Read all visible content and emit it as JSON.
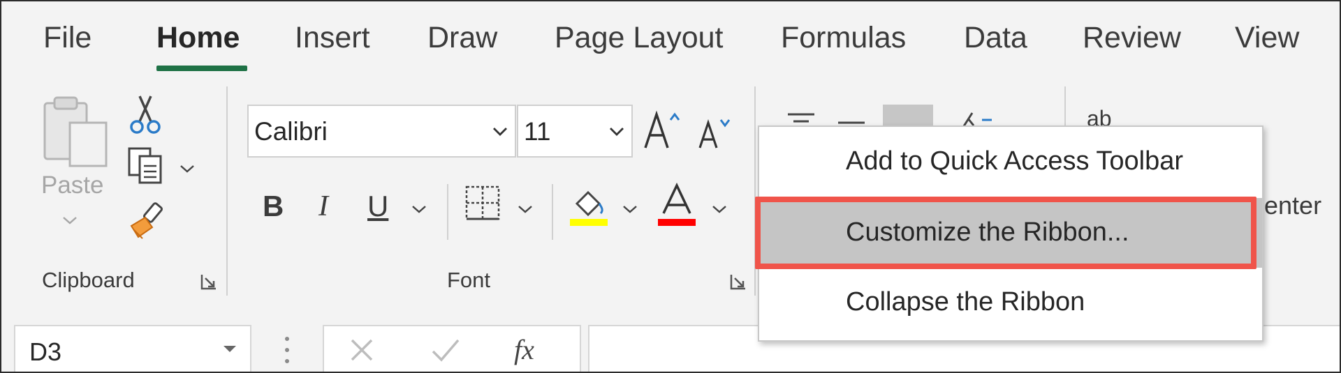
{
  "tabs": [
    {
      "label": "File"
    },
    {
      "label": "Home"
    },
    {
      "label": "Insert"
    },
    {
      "label": "Draw"
    },
    {
      "label": "Page Layout"
    },
    {
      "label": "Formulas"
    },
    {
      "label": "Data"
    },
    {
      "label": "Review"
    },
    {
      "label": "View"
    }
  ],
  "active_tab": "Home",
  "clipboard": {
    "paste_label": "Paste",
    "group_label": "Clipboard"
  },
  "font": {
    "font_name": "Calibri",
    "font_size": "11",
    "bold_label": "B",
    "italic_label": "I",
    "underline_label": "U",
    "group_label": "Font",
    "fill_color": "#ffff00",
    "font_color": "#ff0000"
  },
  "alignment": {
    "partial_text": "enter"
  },
  "styles": {
    "partial_text": "ab"
  },
  "context_menu": {
    "items": [
      {
        "label": "Add to Quick Access Toolbar"
      },
      {
        "label": "Customize the Ribbon..."
      },
      {
        "label": "Collapse the Ribbon"
      }
    ],
    "highlight_color": "#f0544a"
  },
  "formula_bar": {
    "name_box": "D3",
    "fx_label": "fx"
  },
  "colors": {
    "accent": "#1e7145"
  }
}
